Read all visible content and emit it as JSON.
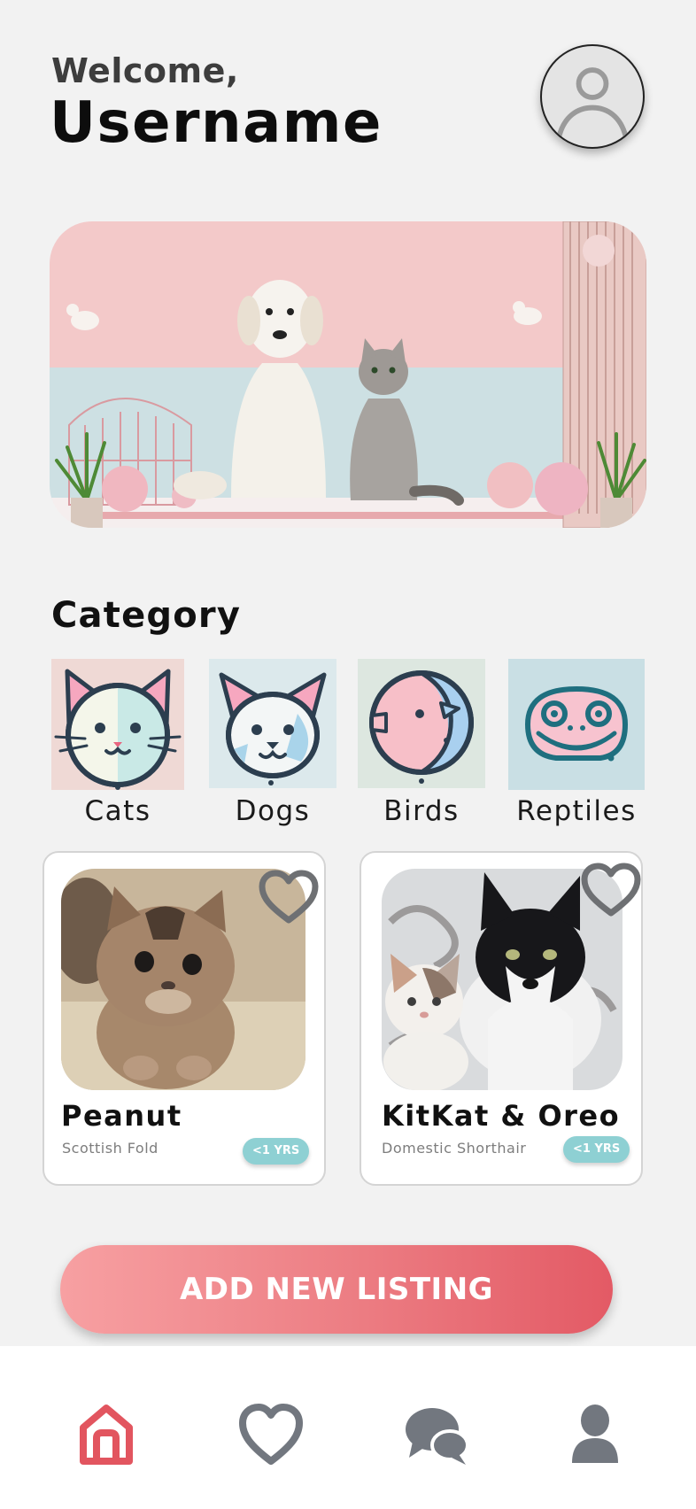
{
  "header": {
    "greeting": "Welcome,",
    "username": "Username"
  },
  "avatar": {
    "icon": "user-avatar-icon"
  },
  "category": {
    "title": "Category",
    "items": [
      {
        "label": "Cats",
        "icon": "cat-icon"
      },
      {
        "label": "Dogs",
        "icon": "dog-icon"
      },
      {
        "label": "Birds",
        "icon": "bird-icon"
      },
      {
        "label": "Reptiles",
        "icon": "reptile-icon"
      }
    ]
  },
  "listings": [
    {
      "name": "Peanut",
      "breed": "Scottish Fold",
      "age": "<1 YRS",
      "favorite_icon": "heart-outline-icon"
    },
    {
      "name": "KitKat & Oreo",
      "breed": "Domestic Shorthair",
      "age": "<1 YRS",
      "favorite_icon": "heart-outline-icon"
    }
  ],
  "actions": {
    "add_listing": "ADD NEW LISTING"
  },
  "nav": [
    {
      "name": "home",
      "icon": "home-icon",
      "active": true
    },
    {
      "name": "favorites",
      "icon": "heart-icon",
      "active": false
    },
    {
      "name": "messages",
      "icon": "chat-icon",
      "active": false
    },
    {
      "name": "profile",
      "icon": "person-icon",
      "active": false
    }
  ],
  "colors": {
    "background": "#f2f2f2",
    "accent": "#e2555f",
    "badge": "#8ed0d3",
    "nav_inactive": "#72777f"
  }
}
